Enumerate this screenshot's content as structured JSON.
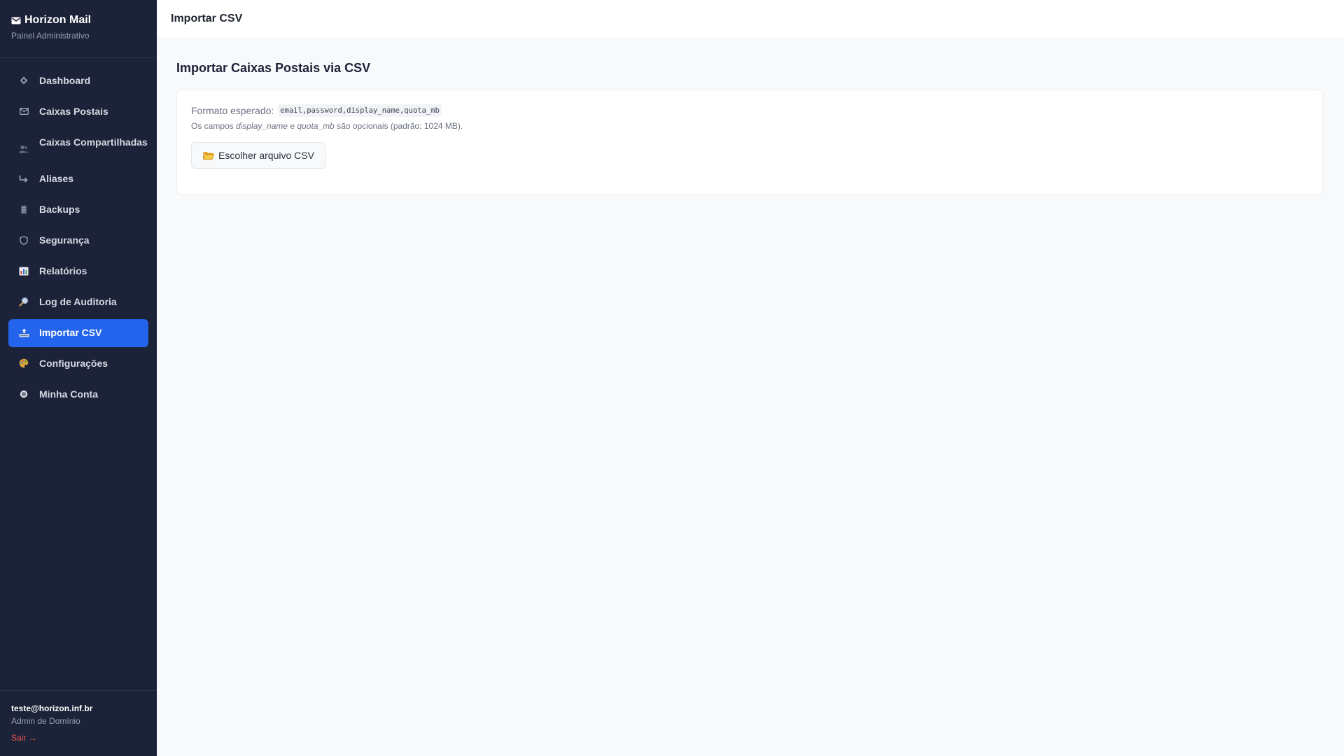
{
  "brand": {
    "name": "Horizon Mail",
    "subtitle": "Painel Administrativo"
  },
  "sidebar": {
    "items": [
      {
        "label": "Dashboard",
        "icon": "diamond-icon"
      },
      {
        "label": "Caixas Postais",
        "icon": "envelope-icon"
      },
      {
        "label": "Caixas Compartilhadas",
        "icon": "users-icon"
      },
      {
        "label": "Aliases",
        "icon": "redirect-arrow-icon"
      },
      {
        "label": "Backups",
        "icon": "database-icon"
      },
      {
        "label": "Segurança",
        "icon": "shield-icon"
      },
      {
        "label": "Relatórios",
        "icon": "bar-chart-icon"
      },
      {
        "label": "Log de Auditoria",
        "icon": "magnifier-icon"
      },
      {
        "label": "Importar CSV",
        "icon": "upload-tray-icon",
        "active": true
      },
      {
        "label": "Configurações",
        "icon": "palette-icon"
      },
      {
        "label": "Minha Conta",
        "icon": "radio-dot-icon"
      }
    ],
    "footer": {
      "email": "teste@horizon.inf.br",
      "role": "Admin de Domínio",
      "logout": "Sair →"
    }
  },
  "header": {
    "title": "Importar CSV"
  },
  "main": {
    "title": "Importar Caixas Postais via CSV",
    "format_label": "Formato esperado:",
    "format_code": "email,password,display_name,quota_mb",
    "hint": {
      "prefix": "Os campos ",
      "field1": "display_name",
      "middle": " e ",
      "field2": "quota_mb",
      "suffix": " são opcionais (padrão: 1024 MB)."
    },
    "file_button": "Escolher arquivo CSV"
  },
  "colors": {
    "sidebar_bg": "#1c2237",
    "accent": "#2463eb",
    "logout": "#f05252",
    "page_bg": "#f8f9fb"
  }
}
